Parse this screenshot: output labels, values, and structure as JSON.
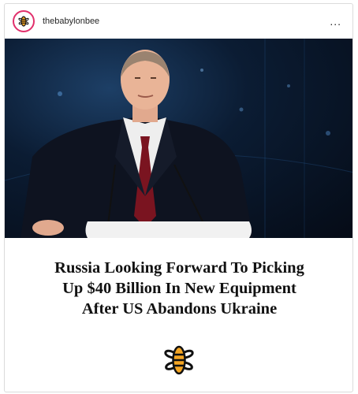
{
  "post": {
    "username": "thebabylonbee",
    "more_label": "...",
    "headline_lines": [
      "Russia Looking Forward To Picking",
      "Up $40 Billion In New Equipment",
      "After US Abandons Ukraine"
    ]
  },
  "colors": {
    "photo_background": "#0b1c33",
    "logo_orange": "#f5a623",
    "text": "#111111"
  },
  "icons": {
    "avatar": "babylon-bee-logo-icon",
    "more": "more-options-icon",
    "brand": "babylon-bee-logo-icon"
  }
}
